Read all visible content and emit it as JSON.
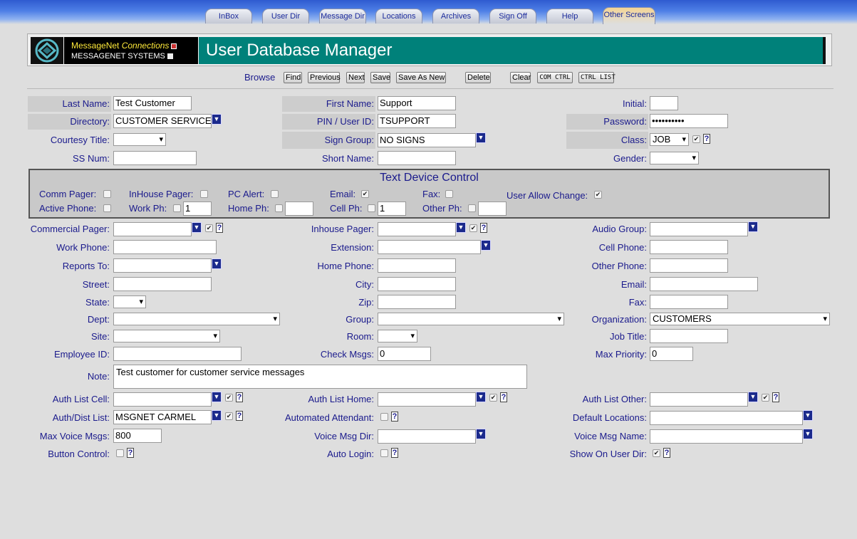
{
  "tabs": [
    "InBox",
    "User Dir",
    "Message Dir",
    "Locations",
    "Archives",
    "Sign Off",
    "Help",
    "Other Screens"
  ],
  "header": {
    "brand_line1": "MessageNet",
    "brand_line1_italic": "Connections",
    "brand_line2": "MESSAGENET SYSTEMS",
    "title": "User Database Manager"
  },
  "actions": {
    "browse": "Browse",
    "find": "Find",
    "previous": "Previous",
    "next": "Next",
    "save": "Save",
    "save_as_new": "Save As New",
    "delete": "Delete",
    "clear": "Clear",
    "com_ctrl": "COM CTRL",
    "ctrl_list": "CTRL LIST"
  },
  "fields": {
    "last_name": {
      "label": "Last Name:",
      "value": "Test Customer"
    },
    "first_name": {
      "label": "First Name:",
      "value": "Support"
    },
    "initial": {
      "label": "Initial:",
      "value": ""
    },
    "directory": {
      "label": "Directory:",
      "value": "CUSTOMER SERVICE"
    },
    "pin": {
      "label": "PIN / User ID:",
      "value": "TSUPPORT"
    },
    "password": {
      "label": "Password:",
      "value": "••••••••••"
    },
    "courtesy_title": {
      "label": "Courtesy Title:",
      "value": ""
    },
    "sign_group": {
      "label": "Sign Group:",
      "value": "NO SIGNS"
    },
    "class": {
      "label": "Class:",
      "value": "JOB"
    },
    "ss_num": {
      "label": "SS Num:",
      "value": ""
    },
    "short_name": {
      "label": "Short Name:",
      "value": ""
    },
    "gender": {
      "label": "Gender:",
      "value": ""
    },
    "commercial_pager": {
      "label": "Commercial Pager:",
      "value": ""
    },
    "inhouse_pager": {
      "label": "Inhouse Pager:",
      "value": ""
    },
    "audio_group": {
      "label": "Audio Group:",
      "value": ""
    },
    "work_phone": {
      "label": "Work Phone:",
      "value": ""
    },
    "extension": {
      "label": "Extension:",
      "value": ""
    },
    "cell_phone": {
      "label": "Cell Phone:",
      "value": ""
    },
    "reports_to": {
      "label": "Reports To:",
      "value": ""
    },
    "home_phone": {
      "label": "Home Phone:",
      "value": ""
    },
    "other_phone": {
      "label": "Other Phone:",
      "value": ""
    },
    "street": {
      "label": "Street:",
      "value": ""
    },
    "city": {
      "label": "City:",
      "value": ""
    },
    "email": {
      "label": "Email:",
      "value": ""
    },
    "state": {
      "label": "State:",
      "value": ""
    },
    "zip": {
      "label": "Zip:",
      "value": ""
    },
    "fax": {
      "label": "Fax:",
      "value": ""
    },
    "dept": {
      "label": "Dept:",
      "value": ""
    },
    "group": {
      "label": "Group:",
      "value": ""
    },
    "organization": {
      "label": "Organization:",
      "value": "CUSTOMERS"
    },
    "site": {
      "label": "Site:",
      "value": ""
    },
    "room": {
      "label": "Room:",
      "value": ""
    },
    "job_title": {
      "label": "Job Title:",
      "value": ""
    },
    "employee_id": {
      "label": "Employee ID:",
      "value": ""
    },
    "check_msgs": {
      "label": "Check Msgs:",
      "value": "0"
    },
    "max_priority": {
      "label": "Max Priority:",
      "value": "0"
    },
    "note": {
      "label": "Note:",
      "value": "Test customer for customer service messages"
    },
    "auth_list_cell": {
      "label": "Auth List Cell:",
      "value": ""
    },
    "auth_list_home": {
      "label": "Auth List Home:",
      "value": ""
    },
    "auth_list_other": {
      "label": "Auth List Other:",
      "value": ""
    },
    "auth_dist_list": {
      "label": "Auth/Dist List:",
      "value": "MSGNET CARMEL"
    },
    "automated_attendant": {
      "label": "Automated Attendant:"
    },
    "default_locations": {
      "label": "Default Locations:",
      "value": ""
    },
    "max_voice_msgs": {
      "label": "Max Voice Msgs:",
      "value": "800"
    },
    "voice_msg_dir": {
      "label": "Voice Msg Dir:",
      "value": ""
    },
    "voice_msg_name": {
      "label": "Voice Msg Name:",
      "value": ""
    },
    "button_control": {
      "label": "Button Control:"
    },
    "auto_login": {
      "label": "Auto Login:"
    },
    "show_on_user_dir": {
      "label": "Show On User Dir:"
    }
  },
  "tdc": {
    "title": "Text Device Control",
    "comm_pager": "Comm Pager:",
    "inhouse_pager": "InHouse Pager:",
    "pc_alert": "PC Alert:",
    "email": "Email:",
    "fax": "Fax:",
    "user_allow_change": "User Allow Change:",
    "active_phone": "Active Phone:",
    "work_ph": "Work Ph:",
    "work_ph_value": "1",
    "home_ph": "Home Ph:",
    "home_ph_value": "",
    "cell_ph": "Cell Ph:",
    "cell_ph_value": "1",
    "other_ph": "Other Ph:",
    "other_ph_value": ""
  },
  "check_glyph": "✔",
  "dd_glyph": "▼",
  "help_glyph": "?",
  "colors": {
    "title_bar": "#00817a",
    "label": "#1a1a8c",
    "tab_bar": "#2f5bd0"
  }
}
